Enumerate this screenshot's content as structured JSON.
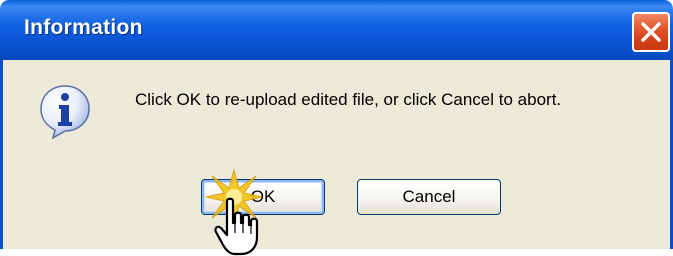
{
  "dialog": {
    "title": "Information",
    "message": "Click OK to re-upload edited file, or click Cancel to abort.",
    "icon": "info-icon",
    "buttons": {
      "ok_label": "OK",
      "cancel_label": "Cancel"
    },
    "close_icon": "close-icon"
  },
  "cursor": {
    "icon": "hand-pointer-icon",
    "effect": "click-burst"
  },
  "colors": {
    "titlebar": "#0a55d4",
    "body": "#ece9d8",
    "close": "#d6401a",
    "burst": "#f2c214"
  }
}
